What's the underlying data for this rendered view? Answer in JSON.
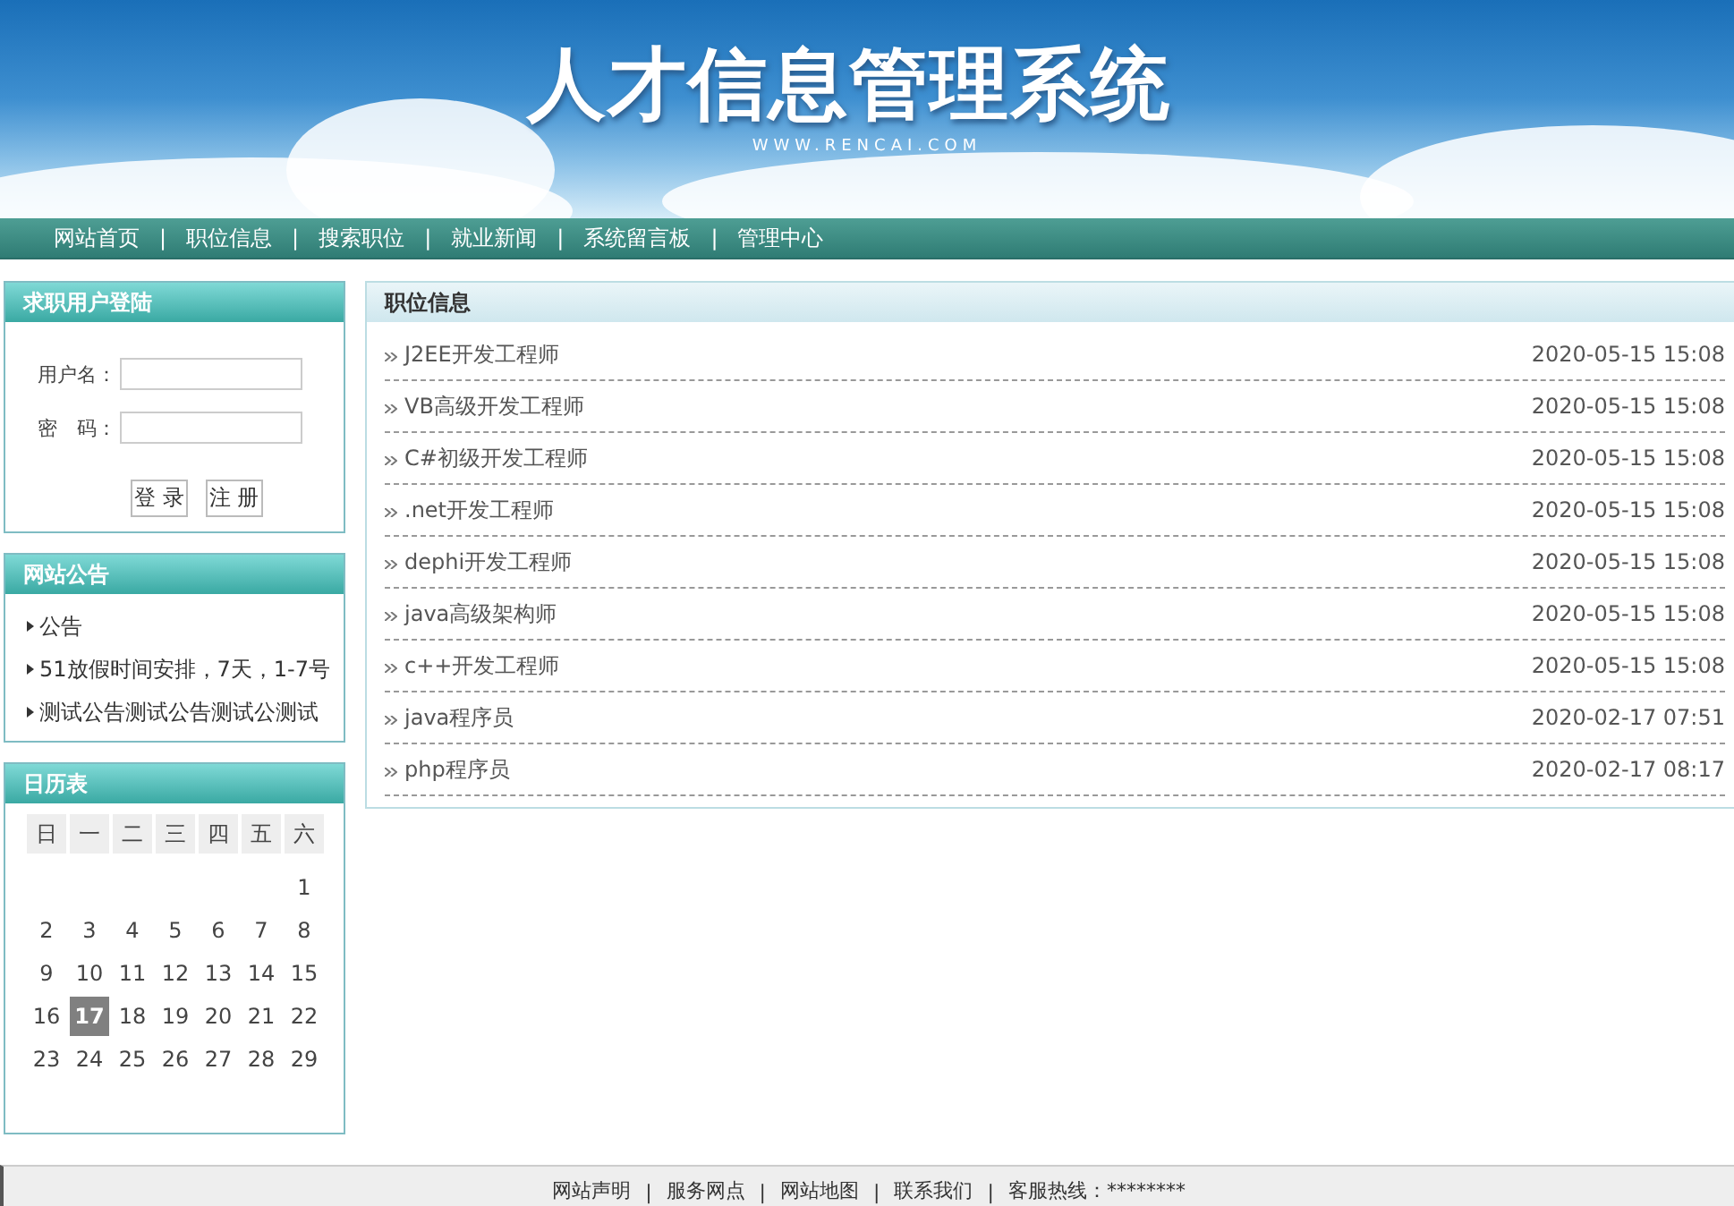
{
  "banner": {
    "title": "人才信息管理系统",
    "subtitle": "WWW.RENCAI.COM"
  },
  "nav": {
    "separator": "|",
    "items": [
      {
        "label": "网站首页"
      },
      {
        "label": "职位信息"
      },
      {
        "label": "搜索职位"
      },
      {
        "label": "就业新闻"
      },
      {
        "label": "系统留言板"
      },
      {
        "label": "管理中心"
      }
    ]
  },
  "login": {
    "title": "求职用户登陆",
    "fields": [
      {
        "label": "用户名："
      },
      {
        "label": "密　码："
      }
    ],
    "buttons": [
      "登 录",
      "注 册"
    ]
  },
  "notices": {
    "title": "网站公告",
    "items": [
      "公告",
      "51放假时间安排，7天，1-7号",
      "测试公告测试公告测试公测试"
    ]
  },
  "calendar": {
    "title": "日历表",
    "weekdays": [
      "日",
      "一",
      "二",
      "三",
      "四",
      "五",
      "六"
    ],
    "weeks": [
      [
        {
          "day": "1",
          "selected": false
        }
      ],
      [
        {
          "day": "2",
          "selected": false
        },
        {
          "day": "3",
          "selected": false
        },
        {
          "day": "4",
          "selected": false
        },
        {
          "day": "5",
          "selected": false
        },
        {
          "day": "6",
          "selected": false
        },
        {
          "day": "7",
          "selected": false
        },
        {
          "day": "8",
          "selected": false
        }
      ],
      [
        {
          "day": "9",
          "selected": false
        },
        {
          "day": "10",
          "selected": false
        },
        {
          "day": "11",
          "selected": false
        },
        {
          "day": "12",
          "selected": false
        },
        {
          "day": "13",
          "selected": false
        },
        {
          "day": "14",
          "selected": false
        },
        {
          "day": "15",
          "selected": false
        }
      ],
      [
        {
          "day": "16",
          "selected": false
        },
        {
          "day": "17",
          "selected": true
        },
        {
          "day": "18",
          "selected": false
        },
        {
          "day": "19",
          "selected": false
        },
        {
          "day": "20",
          "selected": false
        },
        {
          "day": "21",
          "selected": false
        },
        {
          "day": "22",
          "selected": false
        }
      ],
      [
        {
          "day": "23",
          "selected": false
        },
        {
          "day": "24",
          "selected": false
        },
        {
          "day": "25",
          "selected": false
        },
        {
          "day": "26",
          "selected": false
        },
        {
          "day": "27",
          "selected": false
        },
        {
          "day": "28",
          "selected": false
        },
        {
          "day": "29",
          "selected": false
        }
      ]
    ]
  },
  "jobs": {
    "title": "职位信息",
    "rows": [
      {
        "name": "J2EE开发工程师",
        "time": "2020-05-15 15:08"
      },
      {
        "name": "VB高级开发工程师",
        "time": "2020-05-15 15:08"
      },
      {
        "name": "C#初级开发工程师",
        "time": "2020-05-15 15:08"
      },
      {
        "name": ".net开发工程师",
        "time": "2020-05-15 15:08"
      },
      {
        "name": "dephi开发工程师",
        "time": "2020-05-15 15:08"
      },
      {
        "name": "java高级架构师",
        "time": "2020-05-15 15:08"
      },
      {
        "name": "c++开发工程师",
        "time": "2020-05-15 15:08"
      },
      {
        "name": "java程序员",
        "time": "2020-02-17 07:51"
      },
      {
        "name": "php程序员",
        "time": "2020-02-17 08:17"
      }
    ]
  },
  "footer": {
    "separator": "|",
    "links": [
      "网站声明",
      "服务网点",
      "网站地图",
      "联系我们",
      "客服热线：********"
    ]
  }
}
